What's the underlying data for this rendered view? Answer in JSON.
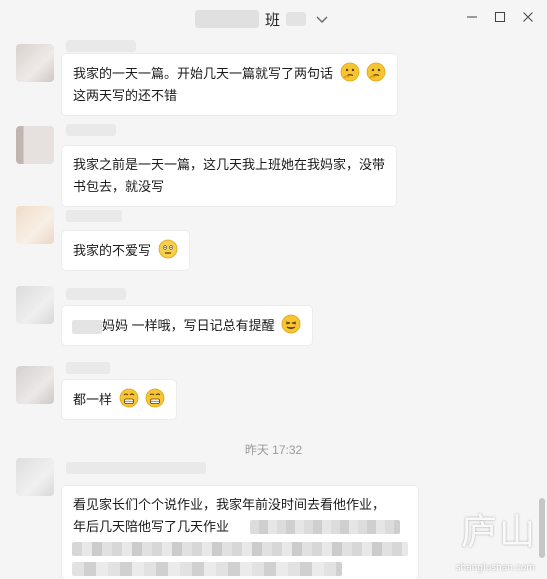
{
  "window": {
    "title": "班",
    "title_suffix": "(",
    "controls": [
      "minimize",
      "maximize",
      "close"
    ]
  },
  "messages": [
    {
      "lines": [
        "我家的一天一篇。开始几天一篇就写了两句话",
        "这两天写的还不错"
      ],
      "emoji": [
        "thinking-face-icon",
        "thinking-face-icon"
      ]
    },
    {
      "lines": [
        "我家之前是一天一篇，这几天我上班她在我妈家，没带",
        "书包去，就没写"
      ],
      "emoji": []
    },
    {
      "lines": [
        "我家的不爱写"
      ],
      "emoji": [
        "awkward-face-icon"
      ]
    },
    {
      "lines": [
        "妈妈 一样哦，写日记总有提醒"
      ],
      "emoji": [
        "wink-face-icon"
      ]
    },
    {
      "lines": [
        "都一样"
      ],
      "emoji": [
        "grin-face-icon",
        "grin-face-icon"
      ]
    },
    {
      "lines": [
        "看见家长们个个说作业，我家年前没时间去看他作业，",
        "年后几天陪他写了几天作业"
      ],
      "emoji": []
    }
  ],
  "timestamp": "昨天 17:32",
  "watermark": {
    "text": "庐山",
    "sub": "shanglushan.com"
  }
}
